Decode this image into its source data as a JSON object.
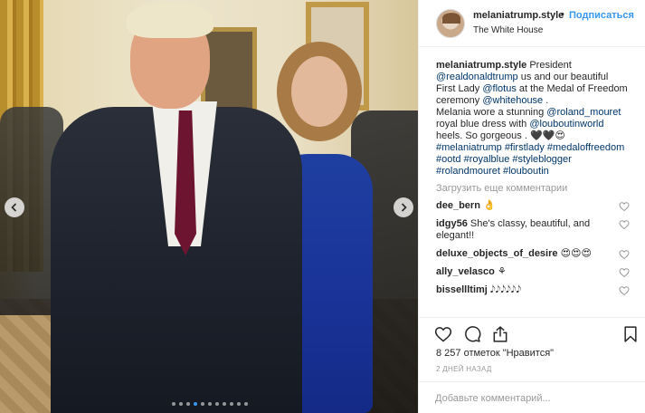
{
  "colors": {
    "accent": "#3897f0",
    "text": "#262626",
    "muted": "#999999",
    "mention": "#003569"
  },
  "post": {
    "image_description_icon": "photo",
    "carousel": {
      "count": 11,
      "active_index": 3
    }
  },
  "header": {
    "username": "melaniatrump.style",
    "separator": "•",
    "follow_label": "Подписаться",
    "location": "The White House"
  },
  "caption": {
    "username": "melaniatrump.style",
    "parts": [
      {
        "t": " President "
      },
      {
        "t": "@realdonaldtrump",
        "m": true
      },
      {
        "t": " us and our beautiful First Lady "
      },
      {
        "t": "@flotus",
        "m": true
      },
      {
        "t": " at the Medal of Freedom ceremony "
      },
      {
        "t": "@whitehouse",
        "m": true
      },
      {
        "t": " .\nMelania wore a stunning "
      },
      {
        "t": "@roland_mouret",
        "m": true
      },
      {
        "t": " royal blue dress with "
      },
      {
        "t": "@louboutinworld",
        "m": true
      },
      {
        "t": " heels. So gorgeous . 🖤🖤😍\n"
      },
      {
        "t": "#melaniatrump #firstlady #medaloffreedom #ootd #royalblue #styleblogger #rolandmouret #louboutin",
        "m": true
      }
    ]
  },
  "load_more": "Загрузить еще комментарии",
  "comments": [
    {
      "username": "dee_bern",
      "text": "👌"
    },
    {
      "username": "idgy56",
      "text": "She's classy, beautiful, and elegant!!"
    },
    {
      "username": "deluxe_objects_of_desire",
      "text": "😍😍😍"
    },
    {
      "username": "ally_velasco",
      "text": "⚘"
    },
    {
      "username": "bissellltimj",
      "text": "𝅘𝅥𝅮𝅘𝅥𝅮𝅘𝅥𝅮𝅘𝅥𝅮𝅘𝅥𝅮𝅘𝅥𝅮"
    }
  ],
  "actions": {
    "like_icon": "heart-icon",
    "comment_icon": "comment-icon",
    "share_icon": "share-icon",
    "save_icon": "bookmark-icon"
  },
  "likes": "8 257 отметок \"Нравится\"",
  "time": "2 ДНЕЙ НАЗАД",
  "add_comment_placeholder": "Добавьте комментарий..."
}
